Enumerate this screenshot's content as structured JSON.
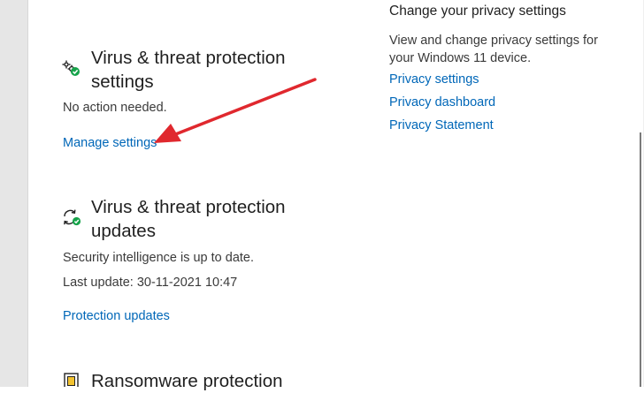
{
  "virus_settings": {
    "title": "Virus & threat protection settings",
    "status": "No action needed.",
    "link_label": "Manage settings",
    "icon": "gear-check-icon"
  },
  "virus_updates": {
    "title": "Virus & threat protection updates",
    "status": "Security intelligence is up to date.",
    "last_update": "Last update: 30-11-2021 10:47",
    "link_label": "Protection updates",
    "icon": "refresh-check-icon"
  },
  "ransomware": {
    "title": "Ransomware protection",
    "icon": "ransomware-icon"
  },
  "privacy": {
    "heading": "Change your privacy settings",
    "description": "View and change privacy settings for your Windows 11 device.",
    "links": [
      "Privacy settings",
      "Privacy dashboard",
      "Privacy Statement"
    ]
  },
  "colors": {
    "link": "#0067b8",
    "annotation_arrow": "#e0282e",
    "status_ok": "#16a34a"
  }
}
